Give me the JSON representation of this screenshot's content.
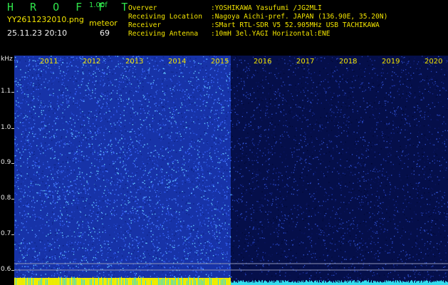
{
  "header": {
    "app_title": "H R O F F T",
    "version": "1.00f",
    "filename": "YY2611232010.png",
    "mode": "meteor",
    "datetime": "25.11.23 20:10",
    "count": "69"
  },
  "info": [
    {
      "label": "Overver",
      "value": ":YOSHIKAWA Yasufumi /JG2MLI"
    },
    {
      "label": "Receiving Location",
      "value": ":Nagoya Aichi-pref. JAPAN (136.90E, 35.20N)"
    },
    {
      "label": "Receiver",
      "value": ":SMart RTL-SDR V5 52.905MHz USB TACHIKAWA"
    },
    {
      "label": "Receiving Antenna",
      "value": ":10mH 3el.YAGI Horizontal:ENE"
    }
  ],
  "plot": {
    "ylabel": "kHz",
    "yticks": [
      "1.1",
      "1.0",
      "0.9",
      "0.8",
      "0.7",
      "0.6"
    ],
    "years": [
      "2011",
      "2012",
      "2013",
      "2014",
      "2015",
      "2016",
      "2017",
      "2018",
      "2019",
      "2020"
    ]
  },
  "colors": {
    "text_green": "#2fe34a",
    "text_yellow": "#f2e400",
    "bright_noise": "#2a4fd0",
    "dark_noise": "#0a1a6e",
    "signal_cyan": "#33ddee"
  }
}
